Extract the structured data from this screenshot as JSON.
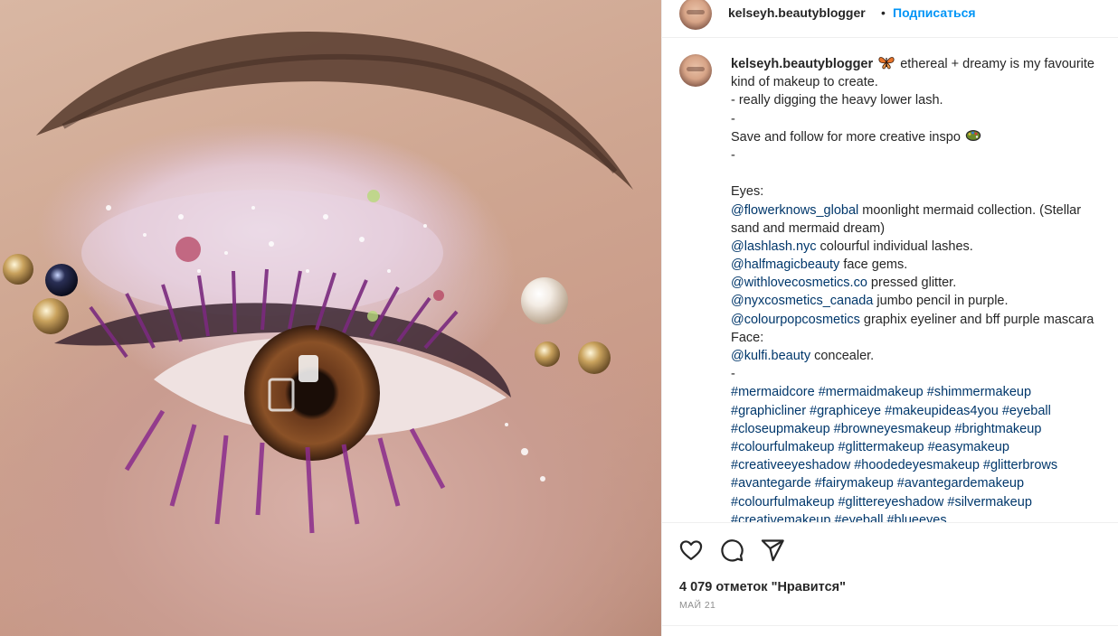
{
  "post": {
    "image_alt": "Close-up of a glittery eye with purple lashes and pearl gems",
    "header": {
      "username": "kelseyh.beautyblogger",
      "separator": "•",
      "follow_label": "Подписаться"
    },
    "caption": {
      "username": "kelseyh.beautyblogger",
      "butterfly_emoji": "butterfly-emoji",
      "lines": [
        {
          "parts": [
            {
              "t": "ethereal + dreamy is my favourite"
            }
          ]
        },
        {
          "parts": [
            {
              "t": "kind of makeup to create."
            }
          ]
        },
        {
          "parts": [
            {
              "t": "- really digging the heavy lower lash."
            }
          ]
        },
        {
          "parts": [
            {
              "t": "-"
            }
          ]
        },
        {
          "parts": [
            {
              "t": "Save and follow for more creative inspo"
            }
          ],
          "emoji": "palette-emoji"
        },
        {
          "parts": [
            {
              "t": "-"
            }
          ]
        },
        {
          "parts": [
            {
              "t": ""
            }
          ]
        },
        {
          "parts": [
            {
              "t": "Eyes:"
            }
          ]
        },
        {
          "parts": [
            {
              "t": "@flowerknows_global",
              "link": true
            },
            {
              "t": " moonlight mermaid collection. (Stellar"
            }
          ]
        },
        {
          "parts": [
            {
              "t": "sand and mermaid dream)"
            }
          ]
        },
        {
          "parts": [
            {
              "t": "@lashlash.nyc",
              "link": true
            },
            {
              "t": " colourful individual lashes."
            }
          ]
        },
        {
          "parts": [
            {
              "t": "@halfmagicbeauty",
              "link": true
            },
            {
              "t": " face gems."
            }
          ]
        },
        {
          "parts": [
            {
              "t": "@withlovecosmetics.co",
              "link": true
            },
            {
              "t": " pressed glitter."
            }
          ]
        },
        {
          "parts": [
            {
              "t": "@nyxcosmetics_canada",
              "link": true
            },
            {
              "t": " jumbo pencil in purple."
            }
          ]
        },
        {
          "parts": [
            {
              "t": "@colourpopcosmetics",
              "link": true
            },
            {
              "t": " graphix eyeliner and bff purple mascara"
            }
          ]
        },
        {
          "parts": [
            {
              "t": "Face:"
            }
          ]
        },
        {
          "parts": [
            {
              "t": "@kulfi.beauty",
              "link": true
            },
            {
              "t": " concealer."
            }
          ]
        },
        {
          "parts": [
            {
              "t": "-"
            }
          ]
        },
        {
          "parts": [
            {
              "t": "#mermaidcore #mermaidmakeup #shimmermakeup",
              "link": true
            }
          ]
        },
        {
          "parts": [
            {
              "t": "#graphicliner #graphiceye #makeupideas4you #eyeball",
              "link": true
            }
          ]
        },
        {
          "parts": [
            {
              "t": "#closeupmakeup #browneyesmakeup #brightmakeup",
              "link": true
            }
          ]
        },
        {
          "parts": [
            {
              "t": "#colourfulmakeup #glittermakeup #easymakeup",
              "link": true
            }
          ]
        },
        {
          "parts": [
            {
              "t": "#creativeeyeshadow #hoodedeyesmakeup #glitterbrows",
              "link": true
            }
          ]
        },
        {
          "parts": [
            {
              "t": "#avantegarde #fairymakeup #avantegardemakeup",
              "link": true
            }
          ]
        },
        {
          "parts": [
            {
              "t": "#colourfulmakeup #glittereyeshadow #silvermakeup",
              "link": true
            }
          ]
        },
        {
          "parts": [
            {
              "t": "#creativemakeup #eyeball #blueeyes",
              "link": true
            }
          ]
        }
      ]
    },
    "actions": {
      "like_icon": "heart-icon",
      "comment_icon": "comment-icon",
      "share_icon": "send-icon"
    },
    "likes_text": "4 079 отметок \"Нравится\"",
    "date_text": "МАЙ 21"
  },
  "colors": {
    "link": "#00376b",
    "follow": "#0095f6",
    "text": "#262626",
    "muted": "#8e8e8e",
    "divider": "#efefef"
  }
}
